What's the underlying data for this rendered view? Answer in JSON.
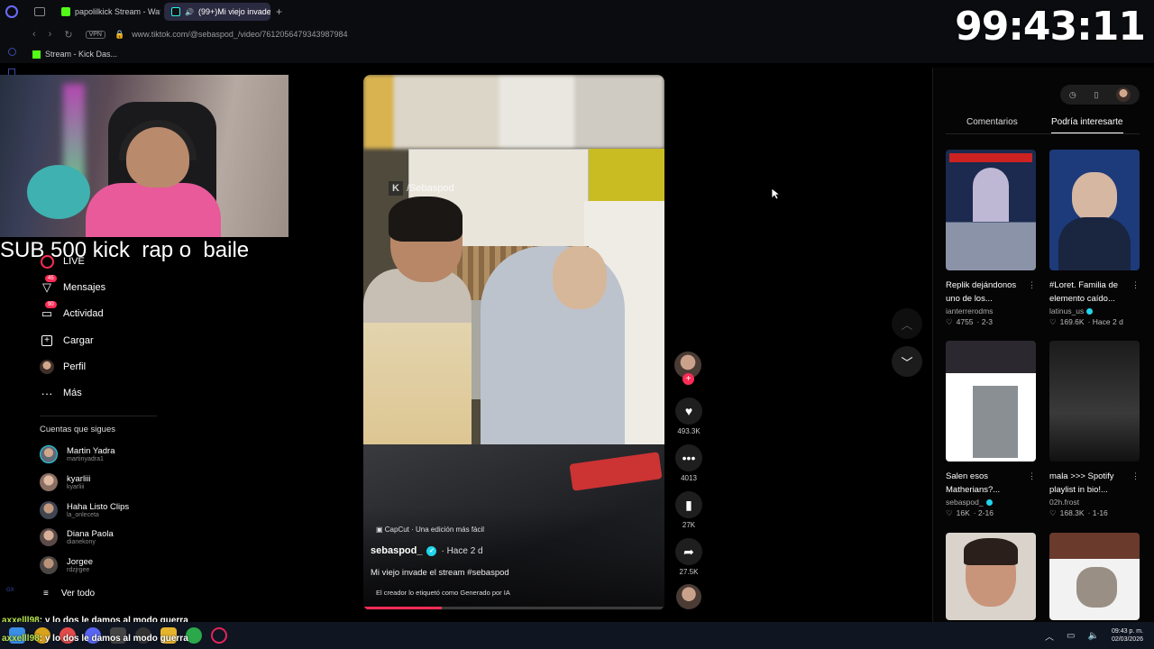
{
  "browser": {
    "tabs": [
      {
        "label": "papolilkick Stream - Watc",
        "active": false
      },
      {
        "label": "(99+)Mi viejo invade e",
        "active": true
      }
    ],
    "url": "www.tiktok.com/@sebaspod_/video/7612056479343987984",
    "vpn_label": "VPN",
    "bookmark": "Stream - Kick Das..."
  },
  "overlay": {
    "timer": "99:43:11",
    "sub_text": "SUB 500 kick  rap o  baile",
    "chat": [
      {
        "user": "axxelll98",
        "text": ": y lo dos le damos al modo guerra"
      },
      {
        "user": "axxelll98",
        "text": ": y lo dos le damos al modo guerra"
      }
    ]
  },
  "nav": {
    "items": [
      {
        "label": "LIVE",
        "icon": "live-icon"
      },
      {
        "label": "Mensajes",
        "icon": "messages-icon",
        "badge": "45"
      },
      {
        "label": "Actividad",
        "icon": "activity-icon",
        "badge": "90"
      },
      {
        "label": "Cargar",
        "icon": "upload-icon"
      },
      {
        "label": "Perfil",
        "icon": "profile-icon"
      },
      {
        "label": "Más",
        "icon": "more-icon"
      }
    ],
    "following_title": "Cuentas que sigues",
    "following": [
      {
        "name": "Martin Yadra",
        "user": "martinyadra1"
      },
      {
        "name": "kyarliii",
        "user": "kyarliii"
      },
      {
        "name": "Haha Listo Clips",
        "user": "la_onleceta"
      },
      {
        "name": "Diana Paola",
        "user": "dianekony"
      },
      {
        "name": "Jorgee",
        "user": "rdzjrgee"
      }
    ],
    "see_all": "Ver todo"
  },
  "video": {
    "watermark": "/Sebaspod",
    "capcut": "CapCut · Una edición más fácil",
    "author": "sebaspod_",
    "ago": "· Hace 2 d",
    "description": "Mi viejo invade el stream #sebaspod",
    "ai_label": "El creador lo etiquetó como Generado por IA",
    "progress": 0.26
  },
  "actions": {
    "likes": "493.3K",
    "comments": "4013",
    "saves": "27K",
    "shares": "27.5K"
  },
  "panel": {
    "tabs": [
      "Comentarios",
      "Podría interesarte"
    ],
    "active_tab": 1,
    "cards": [
      {
        "title": "Replik dejándonos uno de los...",
        "author": "ianterrerodms",
        "verified": false,
        "likes": "4755",
        "date": "· 2-3"
      },
      {
        "title": "#Loret. Familia de elemento caído...",
        "author": "latinus_us",
        "verified": true,
        "likes": "169.6K",
        "date": "· Hace 2 d"
      },
      {
        "title": "Salen esos Matherians?...",
        "author": "sebaspod_",
        "verified": true,
        "likes": "16K",
        "date": "· 2-16"
      },
      {
        "title": "mala >>> Spotify playlist in bio!...",
        "author": "02h.frost",
        "verified": false,
        "likes": "168.3K",
        "date": "· 1-16"
      },
      {
        "title": "",
        "author": "",
        "verified": false,
        "likes": "",
        "date": ""
      },
      {
        "title": "",
        "author": "",
        "verified": false,
        "likes": "",
        "date": ""
      }
    ]
  },
  "taskbar": {
    "time": "09:43 p. m.",
    "date": "02/03/2026"
  }
}
